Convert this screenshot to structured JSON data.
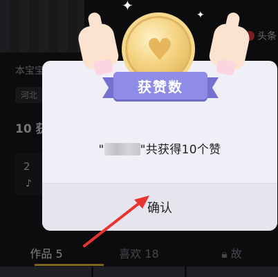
{
  "background": {
    "toutiao_label": "头条",
    "bio": "本宝宝",
    "region": "河北",
    "stat": "10 获",
    "card_number": "2",
    "tabs": [
      {
        "label": "作品 5",
        "active": true
      },
      {
        "label": "喜欢 18",
        "active": false
      },
      {
        "label": "故",
        "active": false
      }
    ]
  },
  "dialog": {
    "ribbon_label": "获赞数",
    "message_prefix": "\"",
    "message_suffix": "\"共获得10个赞",
    "confirm_label": "确认"
  },
  "colors": {
    "dialog_bg": "#f0eff7",
    "ribbon": "#8e8ce6",
    "coin": "#f3d27f",
    "tab_active_underline": "#e6b833",
    "arrow": "#e8332e"
  },
  "icons": [
    "sparkle-icon",
    "heart-icon",
    "thumbs-up-icon",
    "tiktok-icon",
    "lock-icon",
    "toutiao-icon",
    "arrow-icon"
  ]
}
